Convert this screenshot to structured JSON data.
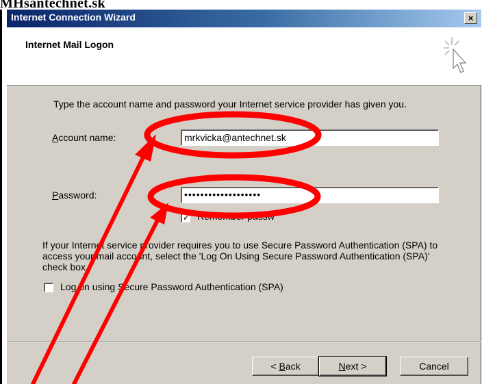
{
  "page_caption": "MHšantechnet.sk",
  "window": {
    "title": "Internet Connection Wizard",
    "close_label": "×"
  },
  "header": {
    "title": "Internet Mail Logon"
  },
  "form": {
    "instruction": "Type the account name and password your Internet service provider has given you.",
    "account_label_accesskey": "A",
    "account_label_rest": "ccount name:",
    "account_value": "mrkvicka@antechnet.sk",
    "password_label_accesskey": "P",
    "password_label_rest": "assword:",
    "password_value": "•••••••••••••••••••",
    "remember_label": "Remember passw",
    "spa_paragraph": "If your Internet service provider requires you to use Secure Password Authentication (SPA) to access your mail account, select the 'Log On Using Secure Password Authentication (SPA)' check box.",
    "spa_checkbox_label": "Log on using Secure Password Authentication (SPA)"
  },
  "buttons": {
    "back_prefix": "< ",
    "back_key": "B",
    "back_rest": "ack",
    "next_key": "N",
    "next_rest": "ext >",
    "cancel": "Cancel"
  },
  "annotation": {
    "color": "#ff0000"
  }
}
